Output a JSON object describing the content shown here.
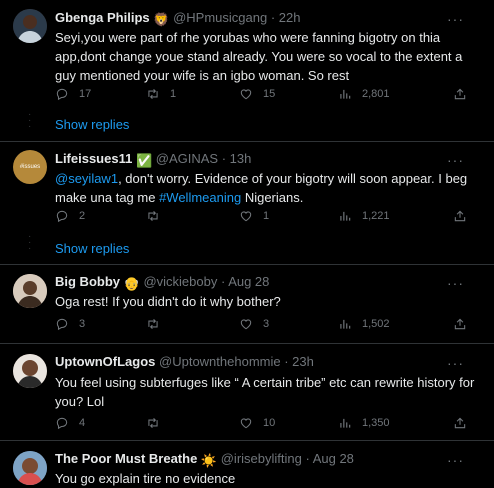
{
  "tweets": [
    {
      "name": "Gbenga Philips",
      "badge": "lion-emoji",
      "handle": "@HPmusicgang",
      "time": "· 22h",
      "text": "Seyi,you were part of rhe yorubas who were fanning bigotry on thia app,dont change youe stand already. You were so vocal to the extent a guy mentioned your wife is an igbo woman. So rest",
      "replies": "17",
      "retweets": "1",
      "likes": "15",
      "views": "2,801",
      "show_replies": "Show replies"
    },
    {
      "name": "Lifeissues11",
      "badge": "check-emoji",
      "handle": "@AGINAS",
      "time": "· 13h",
      "mention": "@seyilaw1",
      "text": ", don't worry. Evidence of your bigotry will soon appear. I beg make una tag me ",
      "hashtag": "#Wellmeaning",
      "text_end": " Nigerians.",
      "avatar_text": "#issues",
      "replies": "2",
      "retweets": "",
      "likes": "1",
      "views": "1,221",
      "show_replies": "Show replies"
    },
    {
      "name": "Big Bobby",
      "badge": "old-man-emoji",
      "handle": "@vickieboby",
      "time": "· Aug 28",
      "text": "Oga rest! If you didn't do it why bother?",
      "replies": "3",
      "retweets": "",
      "likes": "3",
      "views": "1,502"
    },
    {
      "name": "UptownOfLagos",
      "handle": "@Uptownthehommie",
      "time": "· 23h",
      "text": "You feel using subterfuges like “ A certain tribe” etc can rewrite history for you? Lol",
      "replies": "4",
      "retweets": "",
      "likes": "10",
      "views": "1,350"
    },
    {
      "name": "The Poor Must Breathe",
      "badge": "sun-emoji",
      "handle": "@irisebylifting",
      "time": "· Aug 28",
      "text": "You go explain tire no evidence"
    }
  ],
  "colors": {
    "accent": "#1d9bf0",
    "muted": "#71767b",
    "divider": "#2f3336"
  }
}
